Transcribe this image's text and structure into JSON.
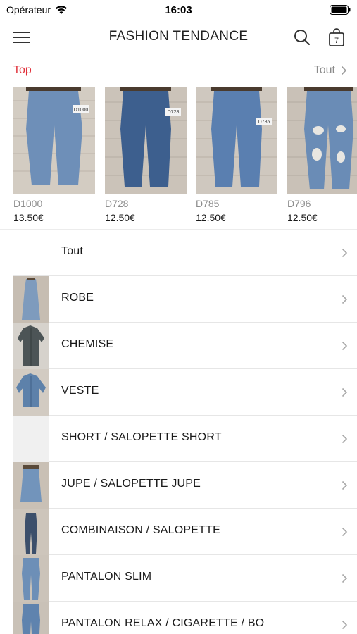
{
  "status": {
    "carrier": "Opérateur",
    "time": "16:03"
  },
  "nav": {
    "title": "FASHION TENDANCE",
    "cart_count": "7"
  },
  "top": {
    "label": "Top",
    "see_all": "Tout",
    "products": [
      {
        "code": "D1000",
        "price": "13.50€",
        "tag": "D1000"
      },
      {
        "code": "D728",
        "price": "12.50€",
        "tag": "D728"
      },
      {
        "code": "D785",
        "price": "12.50€",
        "tag": "D785"
      },
      {
        "code": "D796",
        "price": "12.50€",
        "tag": ""
      }
    ]
  },
  "categories": [
    {
      "label": "Tout"
    },
    {
      "label": "ROBE"
    },
    {
      "label": "CHEMISE"
    },
    {
      "label": "VESTE"
    },
    {
      "label": "SHORT / SALOPETTE SHORT"
    },
    {
      "label": "JUPE / SALOPETTE JUPE"
    },
    {
      "label": "COMBINAISON / SALOPETTE"
    },
    {
      "label": "PANTALON SLIM"
    },
    {
      "label": "PANTALON RELAX / CIGARETTE / BO"
    }
  ],
  "colors": {
    "accent": "#e0303a",
    "muted": "#8a8a8a",
    "denim": "#4a6f9a",
    "brick": "#cfc7bd"
  }
}
